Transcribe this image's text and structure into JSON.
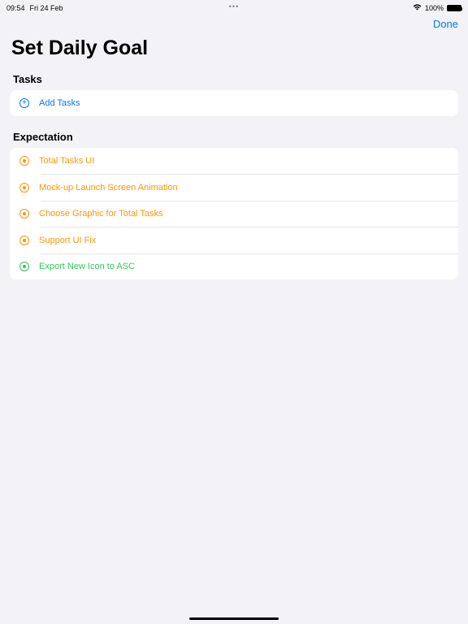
{
  "status": {
    "time": "09:54",
    "date": "Fri 24 Feb",
    "center": "•••",
    "battery_pct": "100%"
  },
  "header": {
    "done_label": "Done",
    "title": "Set Daily Goal"
  },
  "sections": {
    "tasks_header": "Tasks",
    "add_tasks_label": "Add Tasks",
    "expectation_header": "Expectation",
    "items": [
      "Total Tasks UI",
      "Mock-up  Launch Screen Animation",
      "Choose Graphic for Total Tasks",
      "Support UI Fix",
      "Export New Icon to ASC"
    ]
  }
}
